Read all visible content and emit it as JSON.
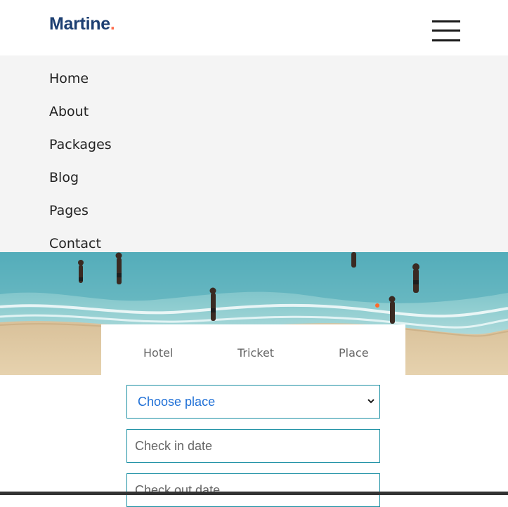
{
  "brand": {
    "name": "Martine",
    "dot": "."
  },
  "menu": {
    "items": [
      {
        "label": "Home"
      },
      {
        "label": "About"
      },
      {
        "label": "Packages"
      },
      {
        "label": "Blog"
      },
      {
        "label": "Pages"
      },
      {
        "label": "Contact"
      }
    ]
  },
  "booking": {
    "tabs": [
      {
        "label": "Hotel"
      },
      {
        "label": "Tricket"
      },
      {
        "label": "Place"
      }
    ],
    "place_select": {
      "value": "Choose place"
    },
    "check_in": {
      "placeholder": "Check in date"
    },
    "check_out": {
      "placeholder": "Check out date"
    }
  },
  "colors": {
    "brand": "#1d3f72",
    "brand_dot": "#ff6b4a",
    "menu_bg": "#f4f4f4",
    "field_border": "#1a8fa3",
    "select_text": "#1e6fd6"
  },
  "icons": {
    "menu": "hamburger-icon",
    "select": "chevron-down-icon"
  }
}
